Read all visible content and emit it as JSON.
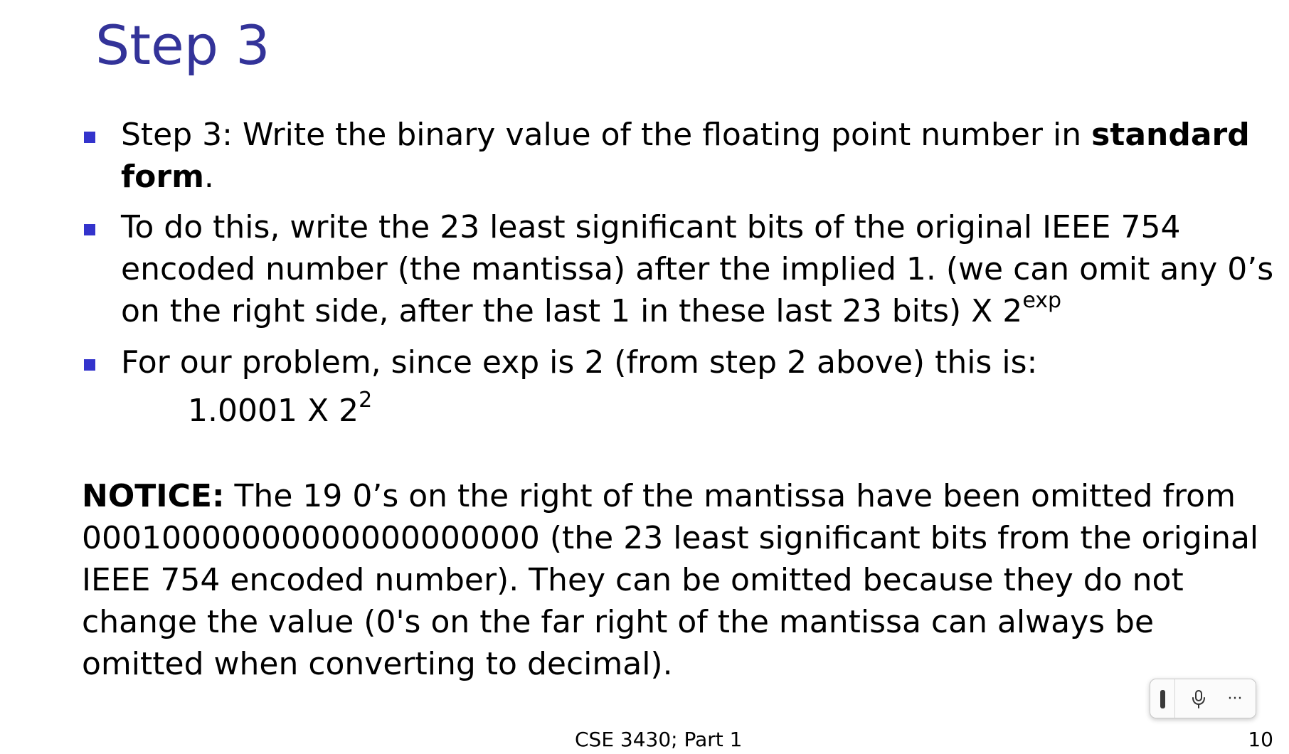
{
  "slide": {
    "title": "Step 3",
    "accent_color": "#333399",
    "bullet_color": "#3333cc"
  },
  "bullets": [
    {
      "line1_text": "Step 3: Write the binary value of the floating point number in ",
      "line1_bold": "standard",
      "line2_bold": "form",
      "line2_text": "."
    },
    {
      "line1": "To do this, write the 23 least significant bits of the original IEEE 754",
      "line2": "encoded number (the mantissa) after the implied 1. (we can omit any 0’s",
      "line3": "on the right side, after the last 1 in these last 23 bits) X 2",
      "superscript": "exp"
    },
    {
      "line1": "For our problem, since exp is 2 (from step 2 above) this is:"
    }
  ],
  "formula": {
    "base": "1.0001 X 2",
    "exponent": "2"
  },
  "notice": {
    "label": "NOTICE:",
    "line1": " The 19 0’s on the right of the mantissa have been omitted from",
    "line2": "00010000000000000000000 (the 23 least significant bits from the original",
    "line3": "IEEE 754 encoded number). They can be omitted because they do not",
    "line4": "change the value (0's on the far right of the mantissa can always be",
    "line5": "omitted when converting to decimal)."
  },
  "footer": {
    "course": "CSE 3430; Part 1",
    "page_number": "10"
  },
  "toolbar": {
    "handle_icon": "drag-handle-icon",
    "mic_icon": "microphone-icon",
    "more_icon": "more-options-icon",
    "more_glyph": "···"
  }
}
